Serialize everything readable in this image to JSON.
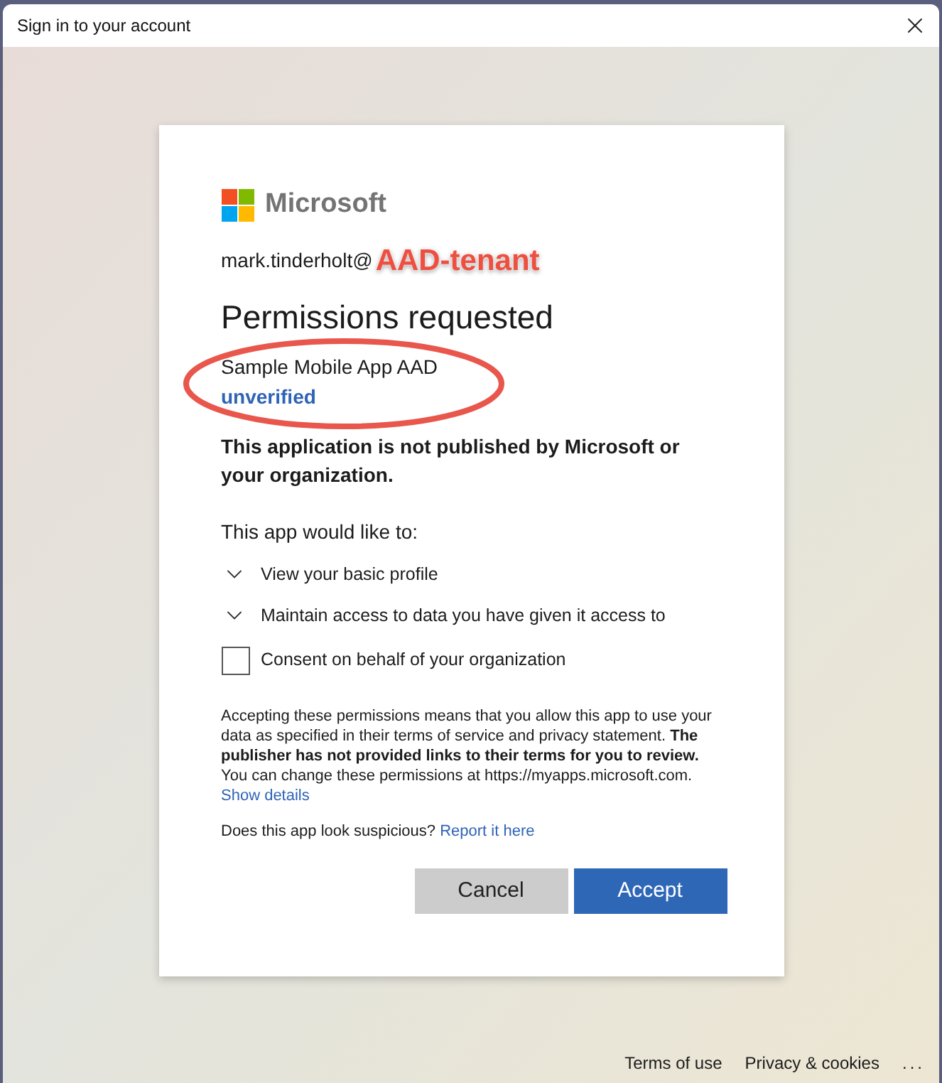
{
  "window": {
    "title": "Sign in to your account"
  },
  "brand": "Microsoft",
  "account": {
    "email": "mark.tinderholt@",
    "annotation": "AAD-tenant"
  },
  "heading": "Permissions requested",
  "app": {
    "name": "Sample Mobile App AAD",
    "status": "unverified",
    "highlighted": true
  },
  "notice": "This application is not published by Microsoft or your organization.",
  "intro": "This app would like to:",
  "permissions": [
    {
      "label": "View your basic profile",
      "expanded": false
    },
    {
      "label": "Maintain access to data you have given it access to",
      "expanded": false
    }
  ],
  "consent": {
    "label": "Consent on behalf of your organization",
    "checked": false
  },
  "disclaimer": {
    "text": "Accepting these permissions means that you allow this app to use your data as specified in their terms of service and privacy statement. **The publisher has not provided links to their terms for you to review.** You can change these permissions at https://myapps.microsoft.com.",
    "link": "Show details"
  },
  "suspicious": {
    "text": "Does this app look suspicious?",
    "link": "Report it here"
  },
  "buttons": [
    {
      "label": "Cancel",
      "kind": "secondary"
    },
    {
      "label": "Accept",
      "kind": "primary"
    }
  ],
  "footer": {
    "links": [
      "Terms of use",
      "Privacy & cookies"
    ],
    "more": "..."
  }
}
